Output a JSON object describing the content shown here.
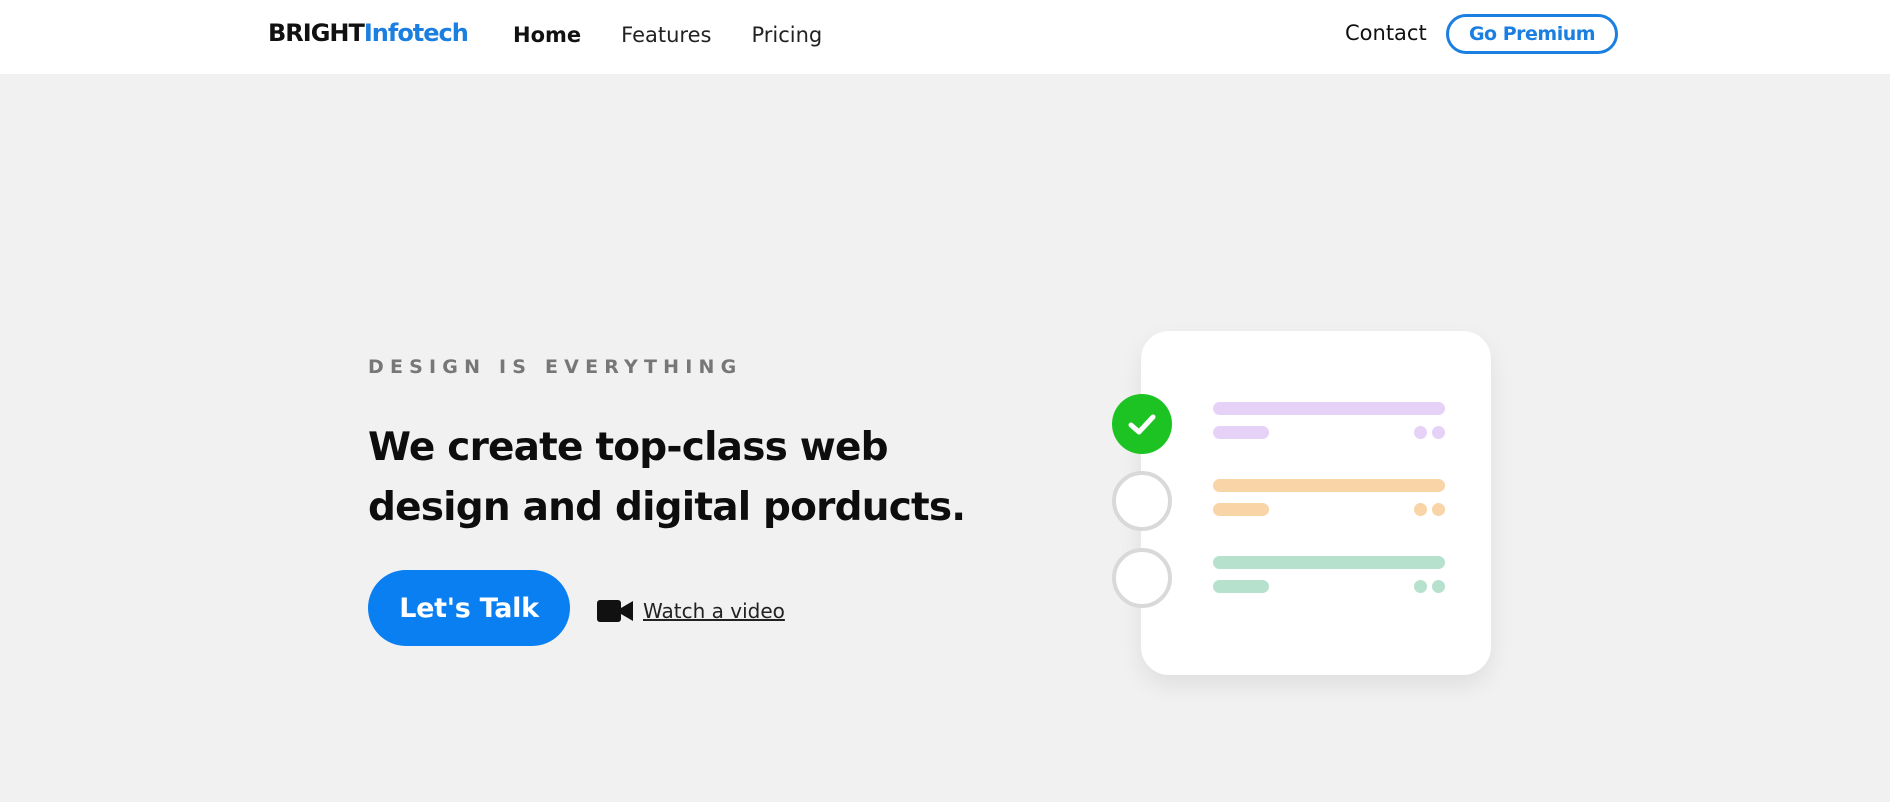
{
  "header": {
    "brand_part1": "BRIGHT",
    "brand_part2": "Infotech",
    "nav": [
      {
        "label": "Home",
        "active": true
      },
      {
        "label": "Features",
        "active": false
      },
      {
        "label": "Pricing",
        "active": false
      }
    ],
    "contact_label": "Contact",
    "premium_label": "Go Premium"
  },
  "hero": {
    "eyebrow": "DESIGN IS EVERYTHING",
    "headline": "We create top-class web design and digital porducts.",
    "cta_label": "Let's Talk",
    "video_label": "Watch a video"
  },
  "illustration": {
    "items": [
      {
        "state": "checked",
        "color": "#e6d2f6"
      },
      {
        "state": "unchecked",
        "color": "#f8d4a6"
      },
      {
        "state": "unchecked",
        "color": "#b6e1cd"
      }
    ]
  },
  "colors": {
    "brand_accent": "#1a7fe0",
    "cta_background": "#0a7ff2",
    "check_green": "#1dc323",
    "page_background": "#f1f1f1"
  },
  "icons": {
    "video": "video-camera-icon",
    "check": "checkmark-icon"
  }
}
